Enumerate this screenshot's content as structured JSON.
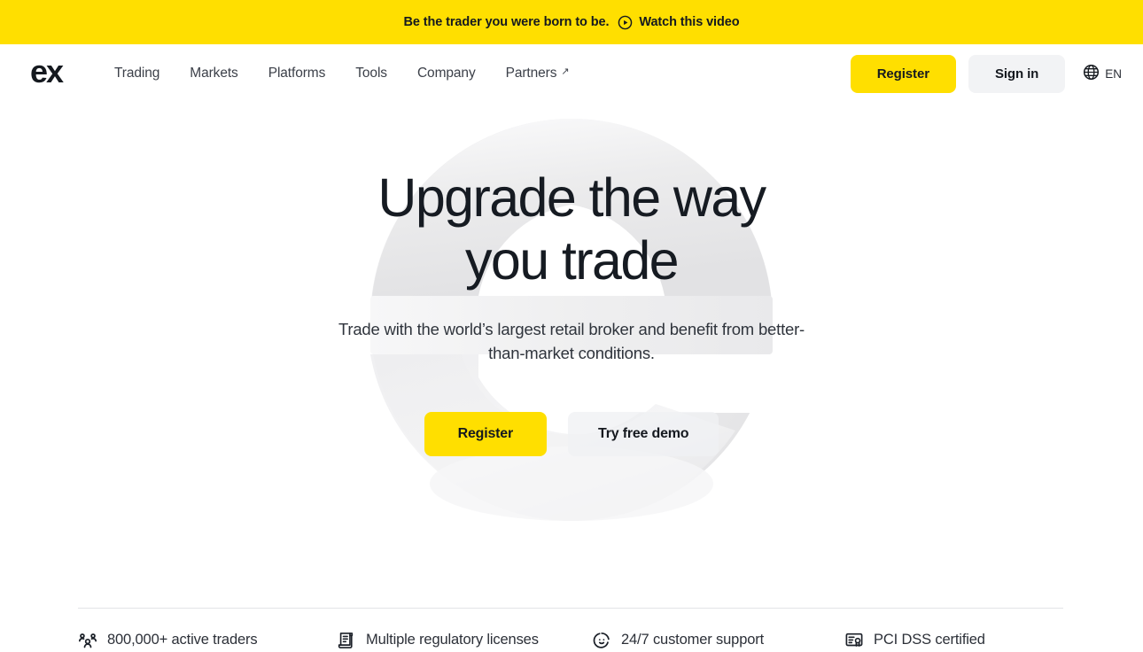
{
  "promo": {
    "text": "Be the trader you were born to be.",
    "link_label": "Watch this video",
    "play_icon": "play-circle-icon",
    "background": "#FFDF00"
  },
  "header": {
    "logo": "ex",
    "nav": [
      {
        "label": "Trading",
        "external": false
      },
      {
        "label": "Markets",
        "external": false
      },
      {
        "label": "Platforms",
        "external": false
      },
      {
        "label": "Tools",
        "external": false
      },
      {
        "label": "Company",
        "external": false
      },
      {
        "label": "Partners",
        "external": true,
        "arrow": "↗"
      }
    ],
    "register_label": "Register",
    "signin_label": "Sign in",
    "language": "EN",
    "globe_icon": "globe-icon"
  },
  "hero": {
    "title_line1": "Upgrade the way",
    "title_line2": "you trade",
    "subtitle_line1": "Trade with the world’s largest retail broker and benefit from",
    "subtitle_line2": "better-than-market conditions.",
    "primary_cta": "Register",
    "secondary_cta": "Try free demo",
    "watermark": "e-logo-watermark"
  },
  "features": [
    {
      "label": "800,000+ active traders",
      "icon": "users-group-icon"
    },
    {
      "label": "Multiple regulatory licenses",
      "icon": "document-scroll-icon"
    },
    {
      "label": "24/7 customer support",
      "icon": "smiley-support-icon"
    },
    {
      "label": "PCI DSS certified",
      "icon": "certificate-icon"
    }
  ],
  "colors": {
    "brand_yellow": "#FFDF00",
    "text_dark": "#15191f",
    "text_muted": "#3c4049",
    "surface_grey": "#f2f3f5",
    "divider": "#e3e4e7"
  }
}
